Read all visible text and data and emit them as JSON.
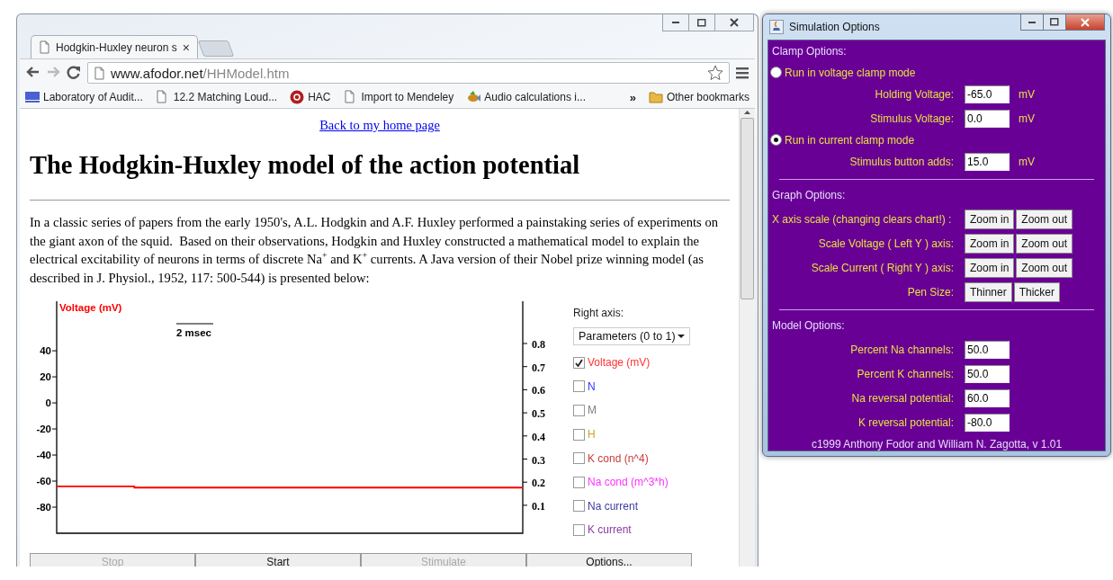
{
  "browser": {
    "tab_title": "Hodgkin-Huxley neuron s",
    "tab_close": "×",
    "url_host": "www.afodor.net",
    "url_path": "/HHModel.htm",
    "bookmarks": [
      {
        "label": "Laboratory of Audit...",
        "kind": "logo"
      },
      {
        "label": "12.2 Matching Loud...",
        "kind": "page"
      },
      {
        "label": "HAC",
        "kind": "round"
      },
      {
        "label": "Import to Mendeley",
        "kind": "page"
      },
      {
        "label": "Audio calculations i...",
        "kind": "fish"
      }
    ],
    "overflow": "»",
    "other_bookmarks": "Other bookmarks"
  },
  "page": {
    "link": "Back to my home page",
    "heading": "The Hodgkin-Huxley model of the action potential",
    "paragraph": "In a classic series of papers from the early 1950's, A.L. Hodgkin and A.F. Huxley performed a painstaking series of experiments on the giant axon of the squid.  Based on their observations, Hodgkin and Huxley constructed a mathematical model to explain the electrical excitability of neurons in terms of discrete Na$^{+}$ and K$^{+}$ currents. A Java version of their Nobel prize winning model (as described in J. Physiol., 1952, 117: 500-544) is presented below:"
  },
  "applet": {
    "chart_data": {
      "type": "line",
      "ylabel": "Voltage (mV)",
      "ylim": [
        -100,
        78
      ],
      "yticks": [
        40,
        20,
        0,
        -20,
        -40,
        -60,
        -80
      ],
      "series": [
        {
          "color": "#ff0000",
          "values": [
            -64,
            -64,
            -65,
            -65,
            -65,
            -65,
            -65,
            -65,
            -65,
            -65,
            -65,
            -65
          ]
        }
      ]
    },
    "scale_bar": "2 msec",
    "right_ticks": [
      "0.8",
      "0.7",
      "0.6",
      "0.5",
      "0.4",
      "0.3",
      "0.2",
      "0.1"
    ],
    "right_axis_label": "Right axis:",
    "right_axis_select": "Parameters (0 to 1)",
    "traces": [
      {
        "label": "Voltage (mV)",
        "checked": true,
        "color": "#ff3333"
      },
      {
        "label": "N",
        "checked": false,
        "color": "#3333ff"
      },
      {
        "label": "M",
        "checked": false,
        "color": "#808080"
      },
      {
        "label": "H",
        "checked": false,
        "color": "#d0a030"
      },
      {
        "label": "K cond (n^4)",
        "checked": false,
        "color": "#c83c3c"
      },
      {
        "label": "Na cond (m^3*h)",
        "checked": false,
        "color": "#ff33ff"
      },
      {
        "label": "Na current",
        "checked": false,
        "color": "#3c3ca0"
      },
      {
        "label": "K current",
        "checked": false,
        "color": "#8c3ca0"
      }
    ],
    "buttons": [
      {
        "label": "Stop",
        "disabled": true
      },
      {
        "label": "Start",
        "disabled": false
      },
      {
        "label": "Stimulate",
        "disabled": true
      },
      {
        "label": "Options...",
        "disabled": false
      }
    ]
  },
  "dialog": {
    "title": "Simulation Options",
    "clamp_heading": "Clamp Options:",
    "modes": [
      {
        "label": "Run in voltage clamp mode",
        "selected": false,
        "fields": [
          {
            "label": "Holding Voltage:",
            "value": "-65.0",
            "unit": "mV"
          },
          {
            "label": "Stimulus Voltage:",
            "value": "0.0",
            "unit": "mV"
          }
        ]
      },
      {
        "label": "Run in current clamp mode",
        "selected": true,
        "fields": [
          {
            "label": "Stimulus button adds:",
            "value": "15.0",
            "unit": "mV"
          }
        ]
      }
    ],
    "graph_heading": "Graph Options:",
    "graph_rows": [
      {
        "label": "X axis scale (changing clears chart!) :",
        "kind": "wide",
        "buttons": [
          "Zoom in",
          "Zoom out"
        ]
      },
      {
        "label": "Scale Voltage ( Left Y ) axis:",
        "kind": "normal",
        "buttons": [
          "Zoom in",
          "Zoom out"
        ]
      },
      {
        "label": "Scale Current ( Right Y ) axis:",
        "kind": "normal",
        "buttons": [
          "Zoom in",
          "Zoom out"
        ]
      },
      {
        "label": "Pen Size:",
        "kind": "normal",
        "buttons": [
          "Thinner",
          "Thicker"
        ]
      }
    ],
    "model_heading": "Model Options:",
    "model_fields": [
      {
        "label": "Percent Na channels:",
        "value": "50.0"
      },
      {
        "label": "Percent K channels:",
        "value": "50.0"
      },
      {
        "label": "Na reversal potential:",
        "value": "60.0"
      },
      {
        "label": "K reversal potential:",
        "value": "-80.0"
      }
    ],
    "footer": "c1999 Anthony Fodor and William N. Zagotta, v 1.01"
  }
}
